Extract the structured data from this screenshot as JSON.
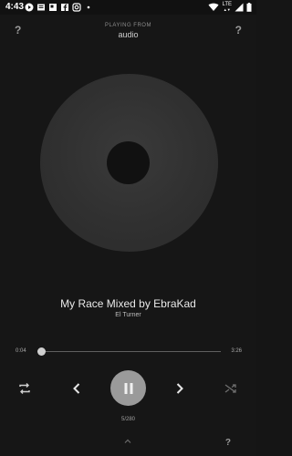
{
  "status_bar": {
    "time": "4:43",
    "network": "LTE",
    "icons": [
      "play-icon",
      "message-icon",
      "news-icon",
      "facebook-icon",
      "instagram-icon",
      "dot-icon"
    ],
    "right_icons": [
      "wifi-icon",
      "lte-signal-icon",
      "cell-signal-icon",
      "battery-icon"
    ]
  },
  "header": {
    "left_icon_label": "?",
    "right_icon_label": "?",
    "playing_from_label": "PLAYING FROM",
    "source": "audio"
  },
  "track": {
    "title": "My Race Mixed by EbraKad",
    "artist": "El Turner"
  },
  "progress": {
    "elapsed": "0:04",
    "total": "3:26",
    "fraction": 0.02
  },
  "controls": {
    "repeat": "repeat-icon",
    "previous": "chevron-left-icon",
    "play_pause": "pause-icon",
    "next": "chevron-right-icon",
    "shuffle": "shuffle-icon"
  },
  "queue": {
    "counter": "5/280"
  },
  "footer": {
    "help_label": "?",
    "expand_icon": "chevron-up-icon"
  },
  "colors": {
    "background": "#161616",
    "disc": "#333333",
    "play_button": "#9a9a9a"
  }
}
